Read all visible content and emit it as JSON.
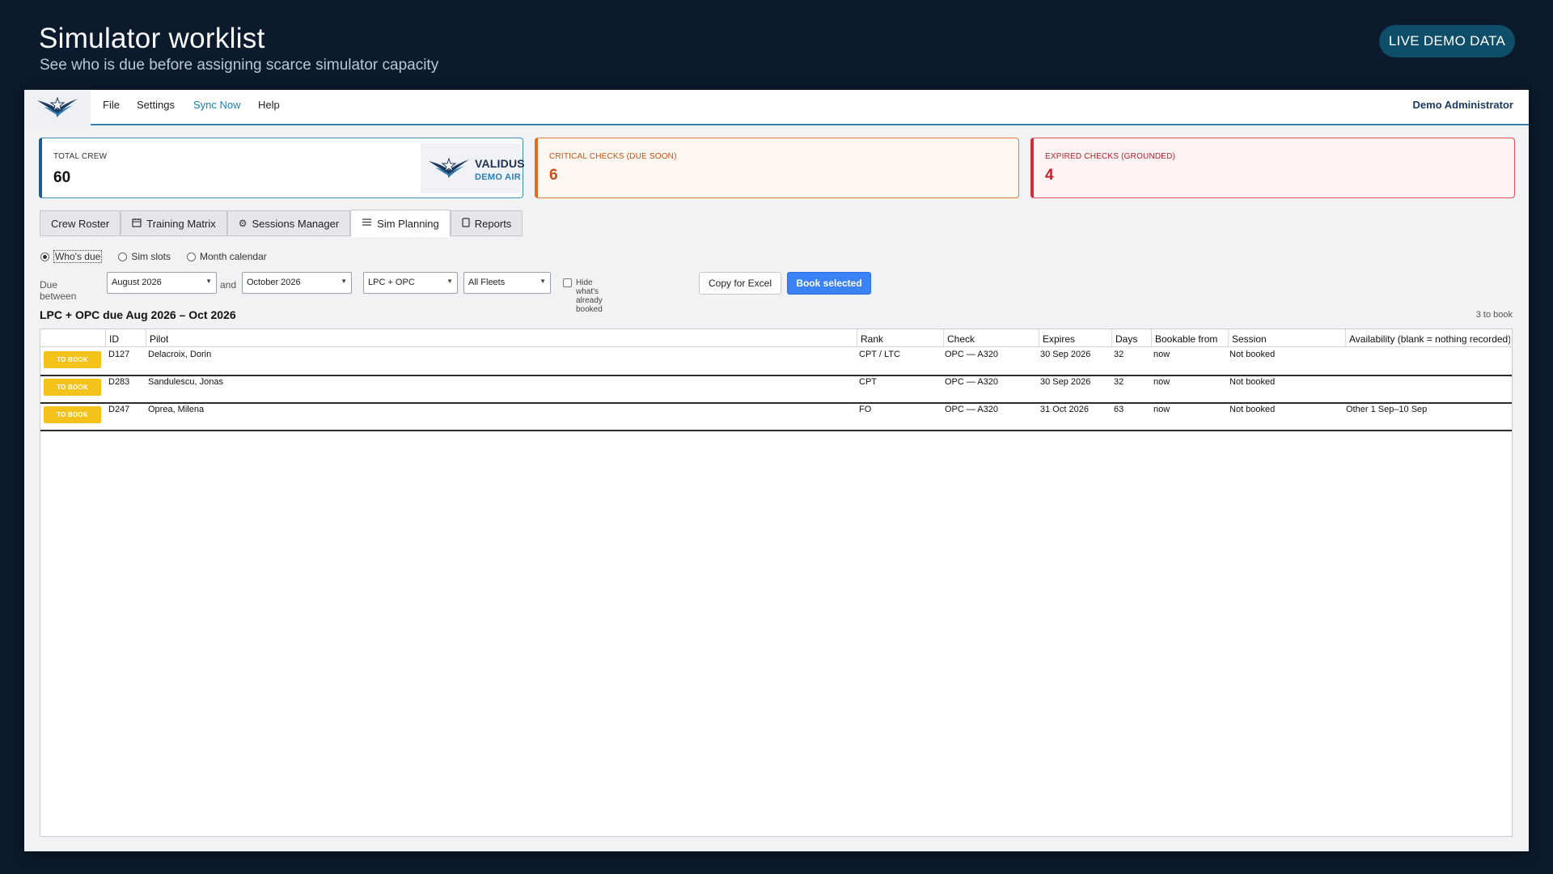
{
  "hero": {
    "title": "Simulator worklist",
    "subtitle": "See who is due before assigning scarce simulator capacity",
    "badge": "LIVE DEMO DATA"
  },
  "menu": {
    "items": [
      "File",
      "Settings",
      "Sync Now",
      "Help"
    ],
    "user": "Demo Administrator"
  },
  "cards": {
    "total": {
      "label": "TOTAL CREW",
      "value": "60"
    },
    "critical": {
      "label": "CRITICAL CHECKS (DUE SOON)",
      "value": "6"
    },
    "expired": {
      "label": "EXPIRED CHECKS (GROUNDED)",
      "value": "4"
    }
  },
  "brand": {
    "name": "VALIDUS",
    "sub": "DEMO AIR"
  },
  "tabs": [
    {
      "label": "Crew Roster",
      "icon": ""
    },
    {
      "label": "Training Matrix",
      "icon": "calendar-icon"
    },
    {
      "label": "Sessions Manager",
      "icon": "gear-icon"
    },
    {
      "label": "Sim Planning",
      "icon": "list-icon",
      "active": true
    },
    {
      "label": "Reports",
      "icon": "document-icon"
    }
  ],
  "view_modes": [
    {
      "label": "Who's due",
      "selected": true
    },
    {
      "label": "Sim slots",
      "selected": false
    },
    {
      "label": "Month calendar",
      "selected": false
    }
  ],
  "filters": {
    "due_between_label": "Due between",
    "from": "August 2026",
    "and_label": "and",
    "to": "October 2026",
    "check_type": "LPC + OPC",
    "fleet": "All Fleets",
    "hide_booked_label": "Hide what's already booked",
    "copy_button": "Copy for Excel",
    "book_button": "Book selected"
  },
  "list": {
    "title": "LPC + OPC due Aug 2026 – Oct 2026",
    "count": "3 to book",
    "columns": [
      "ID",
      "Pilot",
      "Rank",
      "Check",
      "Expires",
      "Days",
      "Bookable from",
      "Session",
      "Availability (blank = nothing recorded)"
    ],
    "rows": [
      {
        "status": "TO BOOK",
        "id": "D127",
        "pilot": "Delacroix, Dorin",
        "rank": "CPT / LTC",
        "check": "OPC — A320",
        "expires": "30 Sep 2026",
        "days": "32",
        "bookable": "now",
        "session": "Not booked",
        "availability": ""
      },
      {
        "status": "TO BOOK",
        "id": "D283",
        "pilot": "Sandulescu, Jonas",
        "rank": "CPT",
        "check": "OPC — A320",
        "expires": "30 Sep 2026",
        "days": "32",
        "bookable": "now",
        "session": "Not booked",
        "availability": ""
      },
      {
        "status": "TO BOOK",
        "id": "D247",
        "pilot": "Oprea, Milena",
        "rank": "FO",
        "check": "OPC — A320",
        "expires": "31 Oct 2026",
        "days": "63",
        "bookable": "now",
        "session": "Not booked",
        "availability": "Other 1 Sep–10 Sep"
      }
    ]
  },
  "colors": {
    "background": "#0b1a2c",
    "accent": "#2f83aa",
    "critical": "#df6c23",
    "expired": "#cf2f36",
    "primary_button": "#3b82f6",
    "to_book": "#f5c21b"
  }
}
